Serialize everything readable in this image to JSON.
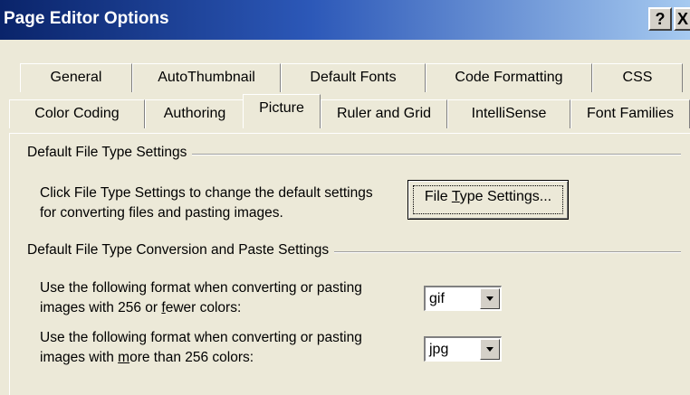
{
  "window": {
    "title": "Page Editor Options",
    "help_label": "?",
    "close_label": "X"
  },
  "tabs": {
    "row_back": [
      "General",
      "AutoThumbnail",
      "Default Fonts",
      "Code Formatting",
      "CSS"
    ],
    "row_front": [
      "Color Coding",
      "Authoring",
      "Picture",
      "Ruler and Grid",
      "IntelliSense",
      "Font Families"
    ],
    "selected": "Picture"
  },
  "section1": {
    "label": "Default File Type Settings",
    "desc_line1": "Click File Type Settings to change the default settings",
    "desc_line2": "for converting files and pasting images.",
    "button_pre": "File ",
    "button_key": "T",
    "button_post": "ype Settings..."
  },
  "section2": {
    "label": "Default File Type Conversion and Paste Settings",
    "row1_line1": "Use the following format when converting or pasting",
    "row1_line2_pre": "images with 256 or ",
    "row1_line2_key": "f",
    "row1_line2_post": "ewer colors:",
    "row1_value": "gif",
    "row2_line1": "Use the following format when converting or pasting",
    "row2_line2_pre": "images with ",
    "row2_line2_key": "m",
    "row2_line2_post": "ore than 256 colors:",
    "row2_value": "jpg"
  }
}
